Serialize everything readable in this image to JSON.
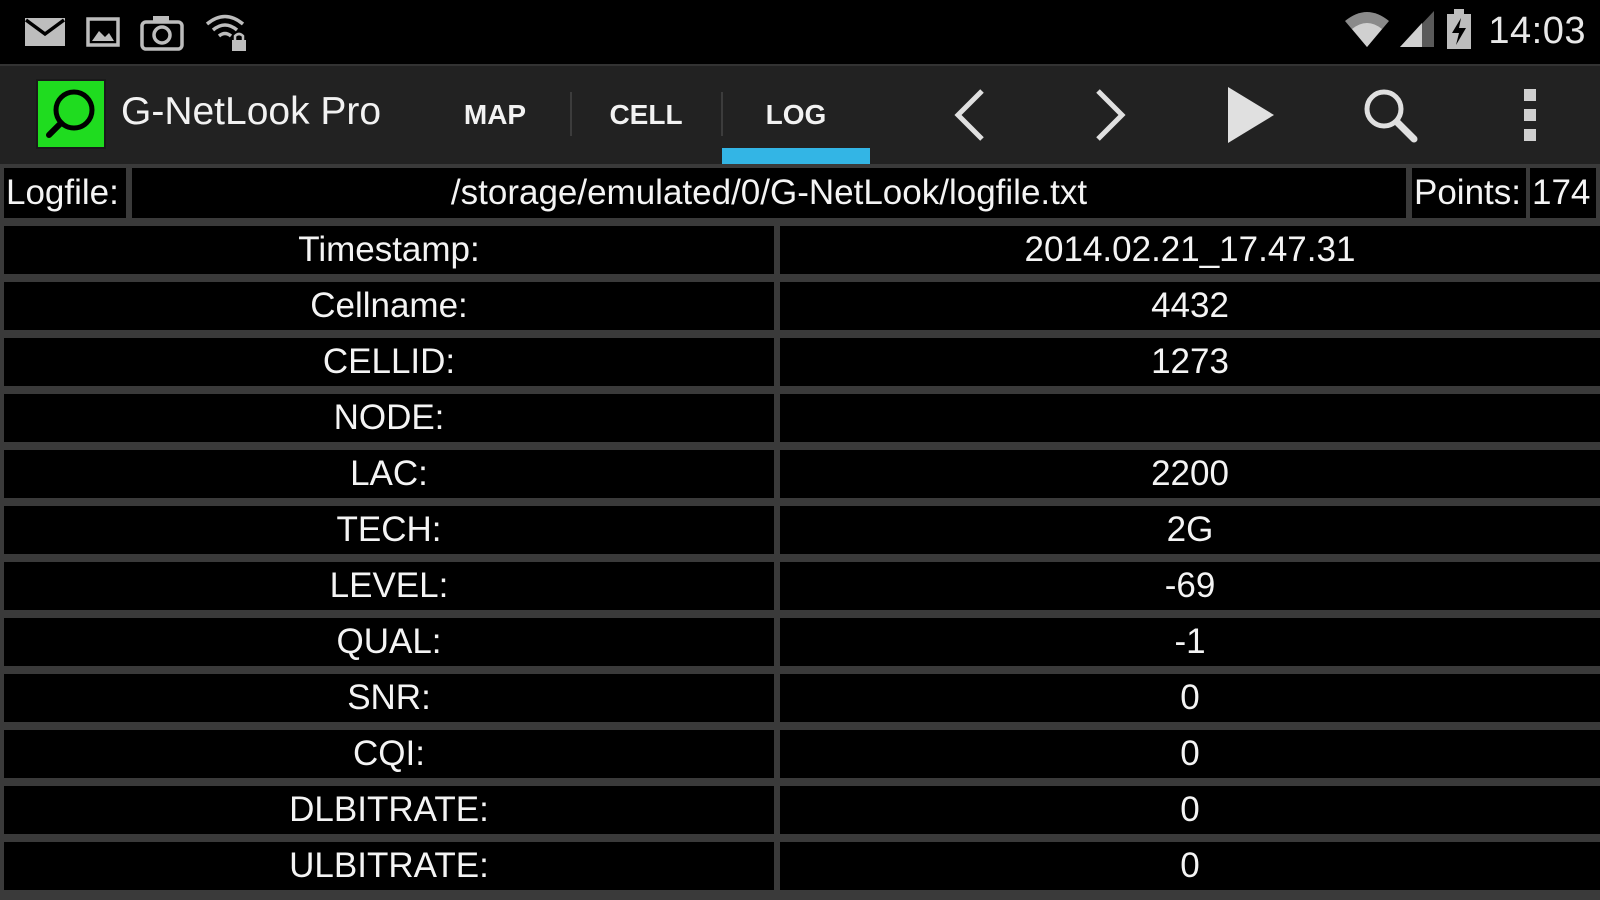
{
  "status_bar": {
    "time": "14:03",
    "left_icons": [
      "mail-icon",
      "gallery-icon",
      "camera-icon",
      "wifi-lock-icon"
    ],
    "right_icons": [
      "wifi-icon",
      "cell-signal-icon",
      "battery-charging-icon"
    ]
  },
  "action_bar": {
    "app_title": "G-NetLook Pro",
    "tabs": [
      {
        "label": "MAP"
      },
      {
        "label": "CELL"
      },
      {
        "label": "LOG",
        "selected": true
      }
    ],
    "accent_color": "#33b5e5",
    "logo_color": "#1fdc1f",
    "actions": [
      "previous-icon",
      "next-icon",
      "play-icon",
      "search-icon",
      "overflow-menu-icon"
    ]
  },
  "logfile": {
    "label": "Logfile:",
    "path": "/storage/emulated/0/G-NetLook/logfile.txt",
    "points_label": "Points:",
    "points_value": "174"
  },
  "rows": [
    {
      "key": "Timestamp:",
      "value": "2014.02.21_17.47.31"
    },
    {
      "key": "Cellname:",
      "value": "4432"
    },
    {
      "key": "CELLID:",
      "value": "1273"
    },
    {
      "key": "NODE:",
      "value": ""
    },
    {
      "key": "LAC:",
      "value": "2200"
    },
    {
      "key": "TECH:",
      "value": "2G"
    },
    {
      "key": "LEVEL:",
      "value": "-69"
    },
    {
      "key": "QUAL:",
      "value": "-1"
    },
    {
      "key": "SNR:",
      "value": "0"
    },
    {
      "key": "CQI:",
      "value": "0"
    },
    {
      "key": "DLBITRATE:",
      "value": "0"
    },
    {
      "key": "ULBITRATE:",
      "value": "0"
    }
  ]
}
